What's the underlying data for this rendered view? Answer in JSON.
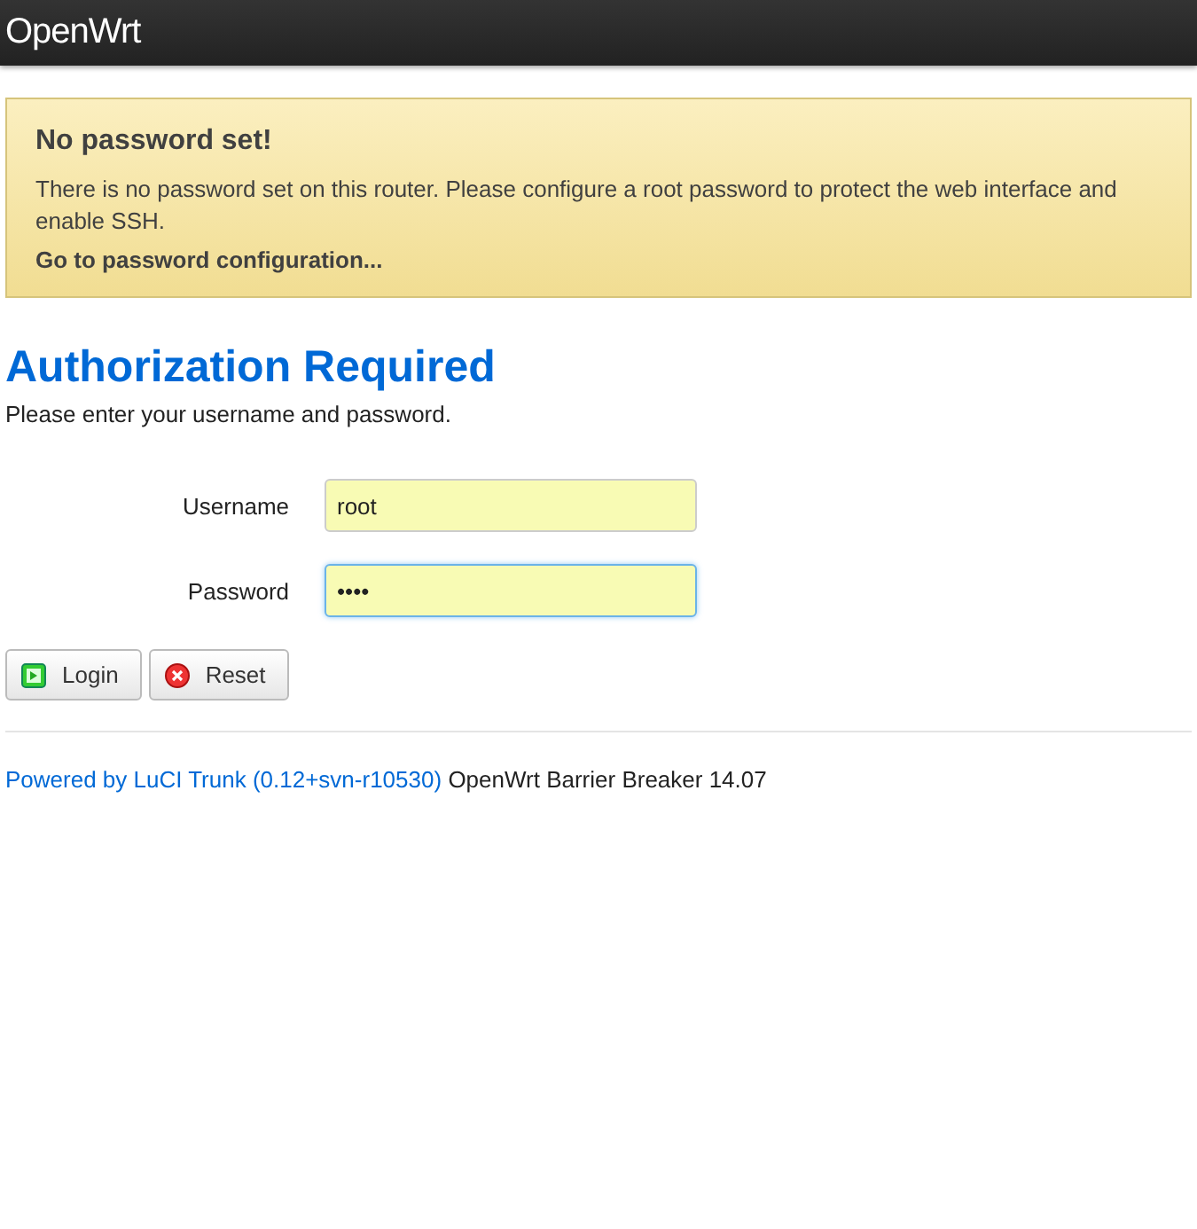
{
  "header": {
    "brand": "OpenWrt"
  },
  "alert": {
    "title": "No password set!",
    "message": "There is no password set on this router. Please configure a root password to protect the web interface and enable SSH.",
    "link": "Go to password configuration..."
  },
  "heading": "Authorization Required",
  "intro": "Please enter your username and password.",
  "fields": [
    {
      "label": "Username",
      "value": "root",
      "focused": false
    },
    {
      "label": "Password",
      "value": "••••",
      "focused": true
    }
  ],
  "buttons": [
    {
      "label": "Login",
      "kind": "apply"
    },
    {
      "label": "Reset",
      "kind": "reset"
    }
  ],
  "footer": {
    "link": "Powered by LuCI Trunk (0.12+svn-r10530)",
    "text": "OpenWrt Barrier Breaker 14.07"
  }
}
